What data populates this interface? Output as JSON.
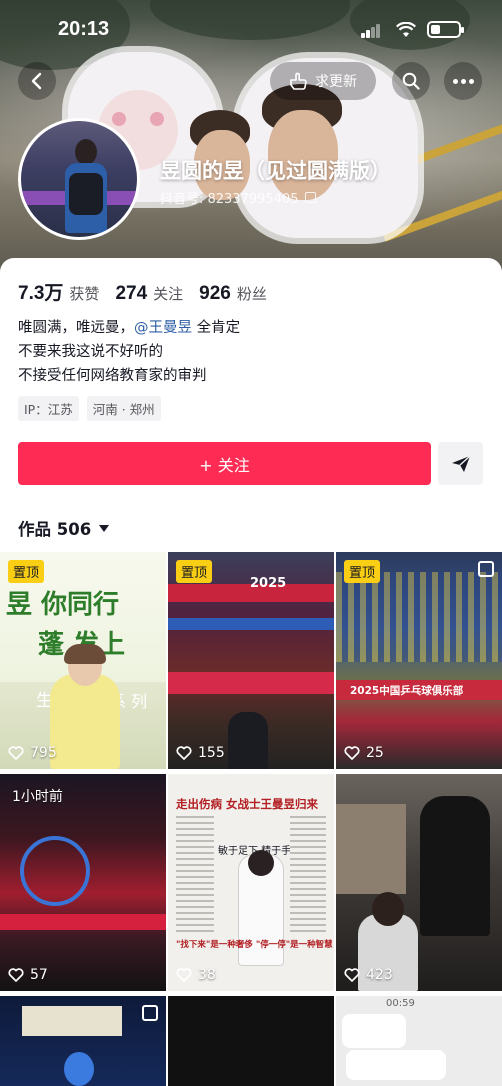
{
  "status_bar": {
    "time": "20:13"
  },
  "header": {
    "update_label": "求更新"
  },
  "profile": {
    "nickname": "昱圆的昱（见过圆满版）",
    "douyin_id": "抖音号: 82337995405"
  },
  "stats": [
    {
      "value": "7.3万",
      "label": "获赞"
    },
    {
      "value": "274",
      "label": "关注"
    },
    {
      "value": "926",
      "label": "粉丝"
    }
  ],
  "bio": {
    "line1_prefix": "唯圆满，唯远曼，",
    "mention": "@王曼昱",
    "line1_suffix": " 全肯定",
    "line2": "不要来我这说不好听的",
    "line3": "不接受任何网络教育家的审判"
  },
  "tags": [
    "IP：江苏",
    "河南 · 郑州"
  ],
  "actions": {
    "follow_label": "+ 关注"
  },
  "works": {
    "label": "作品 506"
  },
  "videos": [
    {
      "badge": "置顶",
      "likes": "795",
      "overlay_1": "昱 你同行",
      "overlay_2": "蓬 发上",
      "overlay_3": "生",
      "overlay_4": "系 列"
    },
    {
      "badge": "置顶",
      "likes": "155",
      "overlay_1": "2025"
    },
    {
      "badge": "置顶",
      "likes": "25",
      "overlay_1": "2025中国乒乓球俱乐部"
    },
    {
      "badge": "1小时前",
      "likes": "57"
    },
    {
      "likes": "38",
      "overlay_1": "走出伤病 女战士王曼昱归来",
      "overlay_2": "敏于足下 精于手中",
      "overlay_3": "\"找下来\"是一种奢侈 \"停一停\"是一种智慧"
    },
    {
      "likes": "423"
    },
    {},
    {},
    {
      "overlay_1": "00:59"
    }
  ]
}
